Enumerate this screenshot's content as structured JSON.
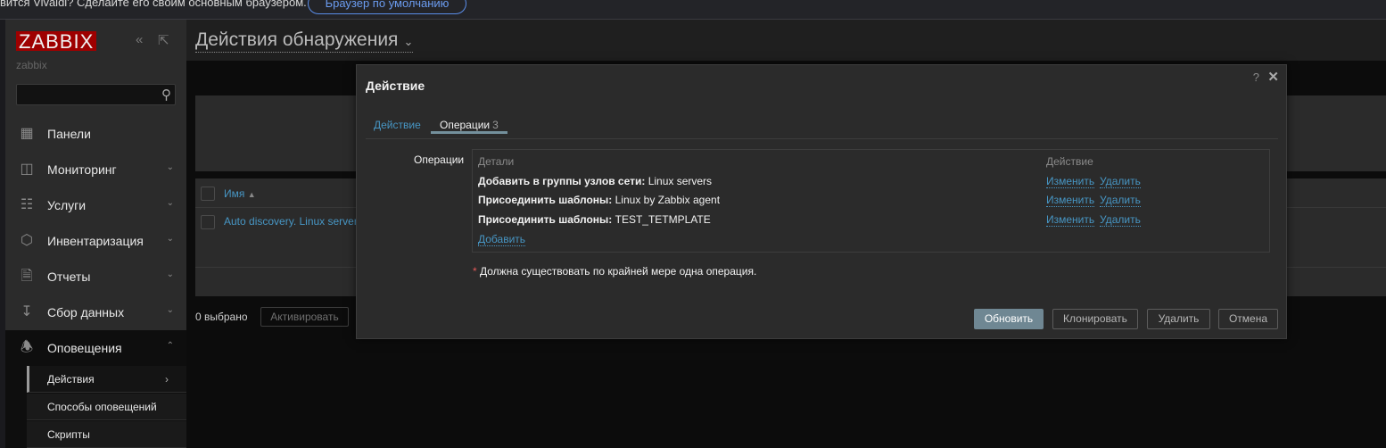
{
  "browser_bar": {
    "message": "вится Vivaldi? Сделайте его своим основным браузером.",
    "default_button": "Браузер по умолчанию"
  },
  "sidebar": {
    "logo": "ZABBIX",
    "server_name": "zabbix",
    "items": [
      {
        "label": "Панели",
        "icon": "dashboard-icon"
      },
      {
        "label": "Мониторинг",
        "icon": "monitoring-icon"
      },
      {
        "label": "Услуги",
        "icon": "services-icon"
      },
      {
        "label": "Инвентаризация",
        "icon": "inventory-icon"
      },
      {
        "label": "Отчеты",
        "icon": "reports-icon"
      },
      {
        "label": "Сбор данных",
        "icon": "data-collection-icon"
      },
      {
        "label": "Оповещения",
        "icon": "bell-icon"
      }
    ],
    "subitems": [
      {
        "label": "Действия"
      },
      {
        "label": "Способы оповещений"
      },
      {
        "label": "Скрипты"
      }
    ]
  },
  "header": {
    "title": "Действия обнаружения"
  },
  "table": {
    "column_name": "Имя",
    "rows": [
      {
        "name": "Auto discovery. Linux servers."
      }
    ],
    "selected": "0 выбрано",
    "activate": "Активировать"
  },
  "modal": {
    "title": "Действие",
    "help": "?",
    "tabs": [
      {
        "label": "Действие"
      },
      {
        "label": "Операции",
        "count": "3"
      }
    ],
    "operations_label": "Операции",
    "columns": {
      "details": "Детали",
      "action": "Действие"
    },
    "operations": [
      {
        "bold": "Добавить в группы узлов сети:",
        "value": " Linux servers"
      },
      {
        "bold": "Присоединить шаблоны:",
        "value": " Linux by Zabbix agent"
      },
      {
        "bold": "Присоединить шаблоны:",
        "value": " TEST_TETMPLATE"
      }
    ],
    "edit": "Изменить",
    "remove": "Удалить",
    "add": "Добавить",
    "note_star": "*",
    "note": " Должна существовать по крайней мере одна операция.",
    "buttons": {
      "update": "Обновить",
      "clone": "Клонировать",
      "delete": "Удалить",
      "cancel": "Отмена"
    },
    "accent": "#4796c4"
  }
}
